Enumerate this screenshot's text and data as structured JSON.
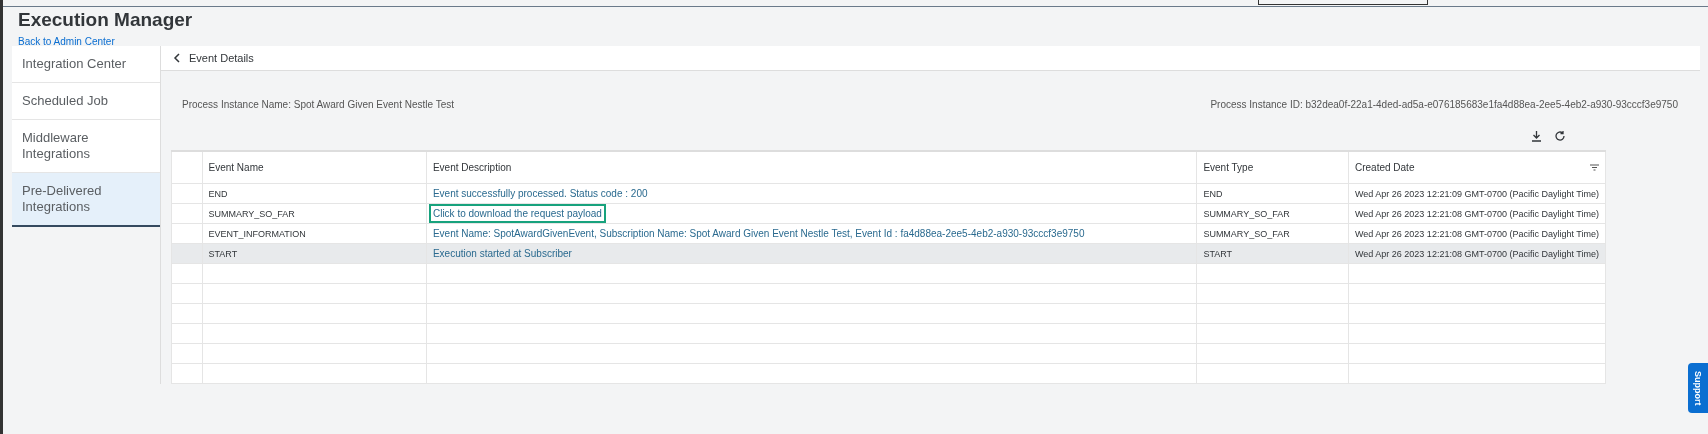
{
  "header": {
    "title": "Execution Manager",
    "back_link": "Back to Admin Center"
  },
  "sidebar": {
    "items": [
      {
        "label": "Integration Center",
        "selected": false
      },
      {
        "label": "Scheduled Job",
        "selected": false
      },
      {
        "label": "Middleware Integrations",
        "selected": false
      },
      {
        "label": "Pre-Delivered Integrations",
        "selected": true
      }
    ]
  },
  "detail": {
    "title": "Event Details",
    "process_name": "Process Instance Name: Spot Award Given Event Nestle Test",
    "process_id": "Process Instance ID: b32dea0f-22a1-4ded-ad5a-e076185683e1fa4d88ea-2ee5-4eb2-a930-93cccf3e9750"
  },
  "table": {
    "columns": [
      "Event Name",
      "Event Description",
      "Event Type",
      "Created Date"
    ],
    "rows": [
      {
        "name": "END",
        "description": "Event successfully processed. Status code : 200",
        "highlighted": false,
        "type": "END",
        "created": "Wed Apr 26 2023 12:21:09 GMT-0700 (Pacific Daylight Time)",
        "selected": false
      },
      {
        "name": "SUMMARY_SO_FAR",
        "description": "Click to download the request payload",
        "highlighted": true,
        "type": "SUMMARY_SO_FAR",
        "created": "Wed Apr 26 2023 12:21:08 GMT-0700 (Pacific Daylight Time)",
        "selected": false
      },
      {
        "name": "EVENT_INFORMATION",
        "description": "Event Name: SpotAwardGivenEvent, Subscription Name: Spot Award Given Event Nestle Test, Event Id : fa4d88ea-2ee5-4eb2-a930-93cccf3e9750",
        "highlighted": false,
        "type": "SUMMARY_SO_FAR",
        "created": "Wed Apr 26 2023 12:21:08 GMT-0700 (Pacific Daylight Time)",
        "selected": false
      },
      {
        "name": "START",
        "description": "Execution started at Subscriber",
        "highlighted": false,
        "type": "START",
        "created": "Wed Apr 26 2023 12:21:08 GMT-0700 (Pacific Daylight Time)",
        "selected": true
      }
    ]
  },
  "support_tab": {
    "label": "Support"
  }
}
